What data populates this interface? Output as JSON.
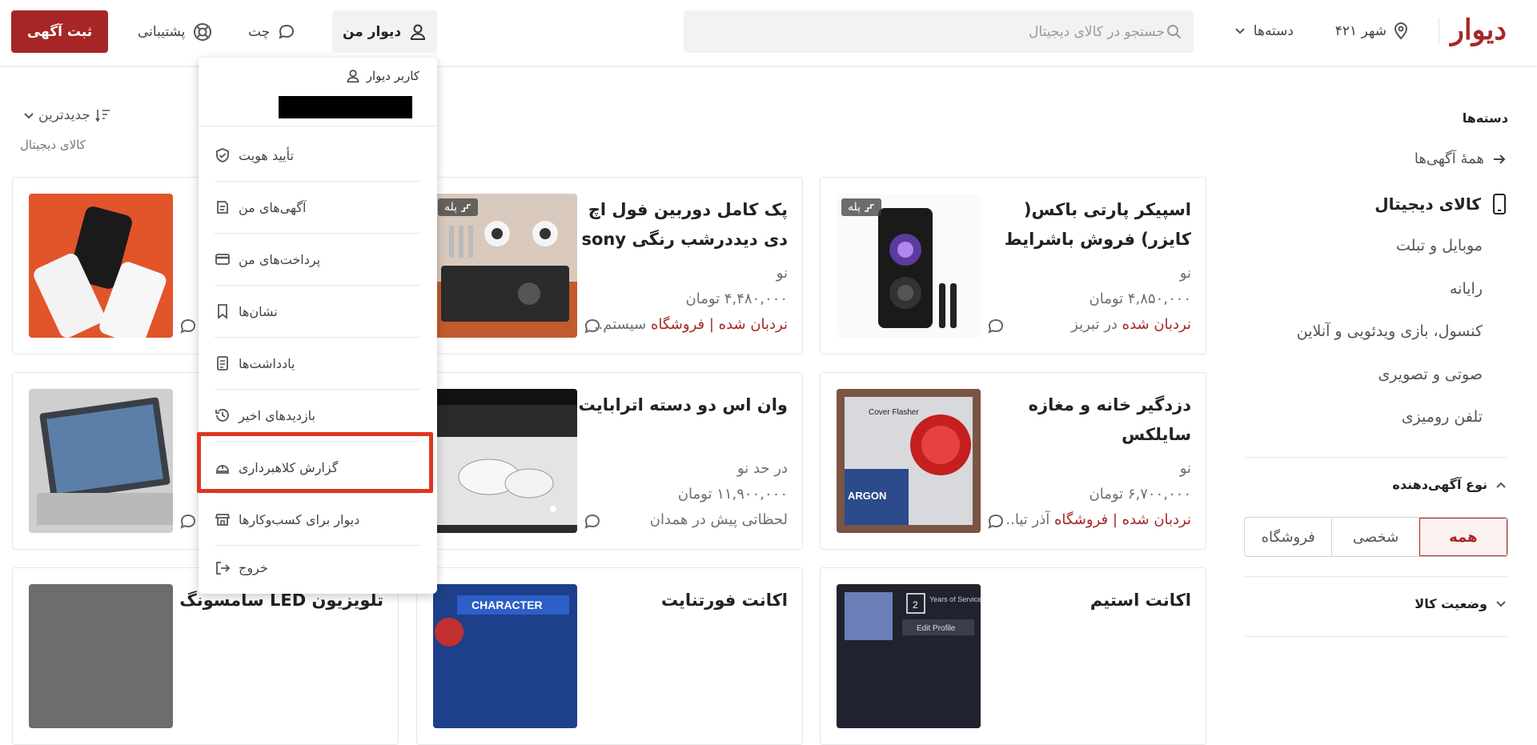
{
  "header": {
    "logo": "دیوار",
    "city": "۴۲۱ شهر",
    "categories": "دسته‌ها",
    "search_placeholder": "جستجو در کالای دیجیتال",
    "my_divar": "دیوار من",
    "chat": "چت",
    "support": "پشتیبانی",
    "post_ad": "ثبت آگهی"
  },
  "sidebar": {
    "title": "دسته‌ها",
    "all_ads": "همهٔ آگهی‌ها",
    "current": "کالای دیجیتال",
    "subcategories": [
      "موبایل و تبلت",
      "رایانه",
      "کنسول، بازی ویدئویی و آنلاین",
      "صوتی و تصویری",
      "تلفن رومیزی"
    ],
    "poster_type_title": "نوع آگهی‌دهنده",
    "poster_types": [
      "همه",
      "شخصی",
      "فروشگاه"
    ],
    "poster_type_selected": "همه",
    "condition_title": "وضعیت کالا"
  },
  "sort": {
    "label": "جدیدترین",
    "breadcrumb": "کالای دیجیتال"
  },
  "listings": [
    {
      "title": "اسپیکر پارتی باکس( کایزر) فروش باشرایط",
      "condition": "نو",
      "price": "۴,۸۵۰,۰۰۰ تومان",
      "ladder": "نردبان شده",
      "location": "در تبریز",
      "badge": "پله"
    },
    {
      "title": "پک کامل دوربین فول اچ دی دیددرشب رنگی sony",
      "condition": "نو",
      "price": "۴,۴۸۰,۰۰۰ تومان",
      "ladder": "نردبان شده",
      "shop": "| فروشگاه",
      "location": "سیستم...",
      "badge": "پله"
    },
    {
      "title": "دزدگیر خانه و مغازه سایلکس",
      "condition": "نو",
      "price": "۶,۷۰۰,۰۰۰ تومان",
      "ladder": "نردبان شده",
      "shop": "| فروشگاه",
      "location": "آذر تیا..."
    },
    {
      "title": "وان اس دو دسته اترابایت",
      "condition": "در حد نو",
      "price": "۱۱,۹۰۰,۰۰۰ تومان",
      "location": "لحظاتی پیش در همدان"
    },
    {
      "title": "اکانت استیم"
    },
    {
      "title": "اکانت فورتنایت"
    },
    {
      "title": "تلویزیون LED سامسونگ"
    }
  ],
  "thumb_text": {
    "display": "Years of Service",
    "edit": "Edit Profile",
    "game": "CHARACTER",
    "alarm": "Cover Flasher",
    "brand": "ARGON"
  },
  "menu": {
    "user": "کاربر دیوار",
    "items": [
      "تأیید هویت",
      "آگهی‌های من",
      "پرداخت‌های من",
      "نشان‌ها",
      "یادداشت‌ها",
      "بازدیدهای اخیر",
      "گزارش کلاهبرداری",
      "دیوار برای کسب‌وکارها",
      "خروج"
    ],
    "highlighted": "گزارش کلاهبرداری"
  },
  "colors": {
    "brand": "#a62626",
    "highlight": "#e0351f"
  }
}
